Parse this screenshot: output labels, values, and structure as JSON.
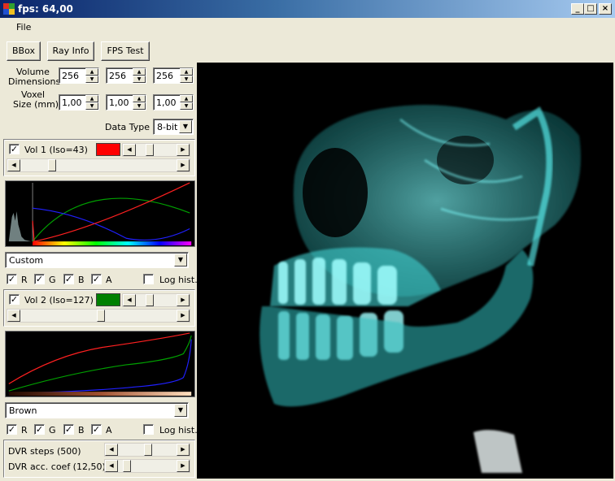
{
  "window": {
    "title": "fps: 64,00"
  },
  "menu": {
    "items": [
      "File"
    ]
  },
  "toolbar": {
    "bbox": "BBox",
    "ray_info": "Ray Info",
    "fps_test": "FPS Test"
  },
  "volume": {
    "dims_label_1": "Volume",
    "dims_label_2": "Dimensions",
    "dims": [
      "256",
      "256",
      "256"
    ],
    "voxel_label_1": "Voxel",
    "voxel_label_2": "Size (mm)",
    "voxel": [
      "1,00",
      "1,00",
      "1,00"
    ],
    "data_type_label": "Data Type",
    "data_type": "8-bit"
  },
  "vol1": {
    "checked": true,
    "label": "Vol 1 (Iso=43)",
    "color": "#ff0000",
    "preset": "Custom",
    "r_label": "R",
    "g_label": "G",
    "b_label": "B",
    "a_label": "A",
    "log_label": "Log hist."
  },
  "vol2": {
    "checked": true,
    "label": "Vol 2 (Iso=127)",
    "color": "#008000",
    "preset": "Brown",
    "r_label": "R",
    "g_label": "G",
    "b_label": "B",
    "a_label": "A",
    "log_label": "Log hist."
  },
  "render": {
    "dvr_steps_label": "DVR steps (500)",
    "dvr_coef_label": "DVR acc. coef (12,50)"
  },
  "colors": {
    "accent_cyan": "#40e0e0",
    "titlebar": "#0a246a"
  }
}
